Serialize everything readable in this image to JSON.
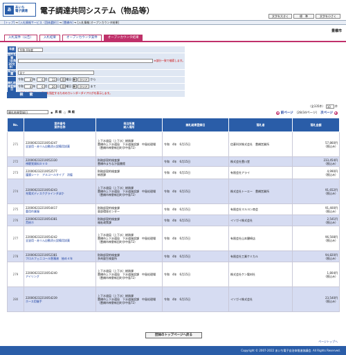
{
  "header": {
    "logo_mark": "あ",
    "logo_line1": "あいち",
    "logo_line2": "電子調達",
    "title": "電子調達共同システム（物品等）",
    "font_buttons": [
      "文字を大きく",
      "標　準",
      "文字を小さく"
    ]
  },
  "breadcrumb": {
    "top": "[トップ]",
    "sep1": " → ",
    "svc": "[入札情報サービス（団体選択）]",
    "sep2": " → ",
    "muni": "[豊橋市]",
    "sep3": " → ",
    "current": "[入札情報:オープンカウンタ結果]"
  },
  "municipality": "豊橋市",
  "tabs": [
    "入札案件（公告）",
    "入札結果",
    "オープンカウンタ案件",
    "オープンカウンタ結果"
  ],
  "form": {
    "year_label": "年度",
    "year_value": "令和 4年度",
    "name_label": "案件名等",
    "name_sub": "（全角30文字）",
    "name_note": "※部分一致で検索します。",
    "method_label": "発注所属",
    "method_value": "全て",
    "date_label": "開札結果登録日",
    "era": "令和",
    "from": {
      "y": "4",
      "yl": "年",
      "m": "6",
      "ml": "月",
      "d": "13",
      "dl": "日",
      "w": "月",
      "wl": "曜日"
    },
    "to": {
      "y": "4",
      "yl": "年",
      "m": "6",
      "ml": "月",
      "d": "20",
      "dl": "日",
      "w": "月",
      "wl": "曜日"
    },
    "clear": "クリア",
    "from_suffix": "から",
    "to_suffix": "まで",
    "cal_note": "※画像を押下すると日付を指定するためのカレンダーダイアログを表示します。",
    "search_button": "検　索"
  },
  "sort": {
    "select": "開札結果登録日",
    "asc": "昇 順",
    "desc": "降 順"
  },
  "pager": {
    "count": "（全335件）",
    "per_page": "10",
    "per_unit": "件",
    "pages": "（28/34ページ）",
    "prev": "前ページ",
    "next": "次ページ"
  },
  "columns": [
    "No.",
    "案件番号\n案件名称",
    "発注所属\n納入場所",
    "開札結果登録日",
    "落札者",
    "落札金額"
  ],
  "rows": [
    {
      "no": "271",
      "id": "220000232210054247",
      "name": "全塗用・赤リん自動消火設備用試薬",
      "dept": "上下水道局（上下水）総務課",
      "place": "豊橋市上下水道局　下水道施設課　中島処理場（豊橋市神野新田町字中島72）",
      "date": "令和　4年　6月15日",
      "winner": "信菱科学株式会社　豊橋営業所",
      "amount": "57,860円",
      "tax": "（税込み）"
    },
    {
      "no": "272",
      "id": "220000232210052330",
      "name": "視聴覚資料ＤＶＤ",
      "dept": "財務部契約検査課",
      "place": "豊橋市まちなか図書館",
      "date": "令和　4年　6月15日",
      "winner": "株式会社豊川堂",
      "amount": "233,454円",
      "tax": "（税込み）"
    },
    {
      "no": "273",
      "id": "220000232210052577",
      "name": "護膜シート　アルコールタイプ　消瘤",
      "dept": "財務部契約検査課",
      "place": "納税課",
      "date": "令和　4年　6月15日",
      "winner": "有限会社アライ",
      "amount": "4,990円",
      "tax": "（税込み）"
    },
    {
      "no": "274",
      "id": "220000232210054243",
      "name": "充電式ディスクグラインダほか",
      "dept": "上下水道局（上下水）総務課",
      "place": "豊橋市上下水道局　下水道施設課　中島処理場（豊橋市神野新田町字中島72）",
      "date": "令和　4年　6月15日",
      "winner": "株式会社トーエー　豊橋営業所",
      "amount": "91,652円",
      "tax": "（税込み）"
    },
    {
      "no": "275",
      "id": "220000232210054417",
      "name": "重用作業服",
      "dept": "財務部契約検査課",
      "place": "東部環境センター",
      "date": "令和　4年　6月15日",
      "winner": "有限会社マルヨン商会",
      "amount": "91,400円",
      "tax": "（税込み）"
    },
    {
      "no": "276",
      "id": "220000232210054381",
      "name": "荒粉ホ",
      "dept": "財務部契約検査課",
      "place": "福祉政策課",
      "date": "令和　4年　6月15日",
      "winner": "イソガイ株式会社",
      "amount": "2,541円",
      "tax": "（税込み）"
    },
    {
      "no": "277",
      "id": "220000232210054242",
      "name": "全塗用・赤リん自動消火設備用試薬",
      "dept": "上下水道局（上下水）総務課",
      "place": "豊橋市上下水道局　下水道施設課　中島処理場（豊橋市神野新田町字中島72）",
      "date": "令和　4年　6月15日",
      "winner": "有限会社山本醸崎店",
      "amount": "96,508円",
      "tax": "（税込み）"
    },
    {
      "no": "278",
      "id": "220000232210052381",
      "name": "フロルフェニコール懸濁液　抽め４年",
      "dept": "財務部契約検査課",
      "place": "多肉量生検査所",
      "date": "令和　4年　6月15日",
      "winner": "有限会社工業ケミカル",
      "amount": "94,820円",
      "tax": "（税込み）"
    },
    {
      "no": "279",
      "id": "220000232210054240",
      "name": "アイリング",
      "dept": "上下水道局（上下水）総務課",
      "place": "豊橋市上下水道局　下水道施設課　中島処理場（豊橋市神野新田町字中島72）",
      "date": "令和　4年　6月15日",
      "winner": "株式会社ケン電材社",
      "amount": "1,804円",
      "tax": "（税込み）"
    },
    {
      "no": "280",
      "id": "220000232210054239",
      "name": "ホース用継手",
      "dept": "上下水道局（上下水）総務課",
      "place": "豊橋市上下水道局　下水道施設課　中島処理場（豊橋市神野新田町字中島72）",
      "date": "令和　4年　6月15日",
      "winner": "イソガイ株式会社",
      "amount": "23,540円",
      "tax": "（税込み）"
    }
  ],
  "back_button": "団体のトップページへ戻る",
  "page_top": "ページトップへ",
  "footer": "Copyright © 2007-2022 あいち電子自治体推進協議会. All Rights Reserved."
}
